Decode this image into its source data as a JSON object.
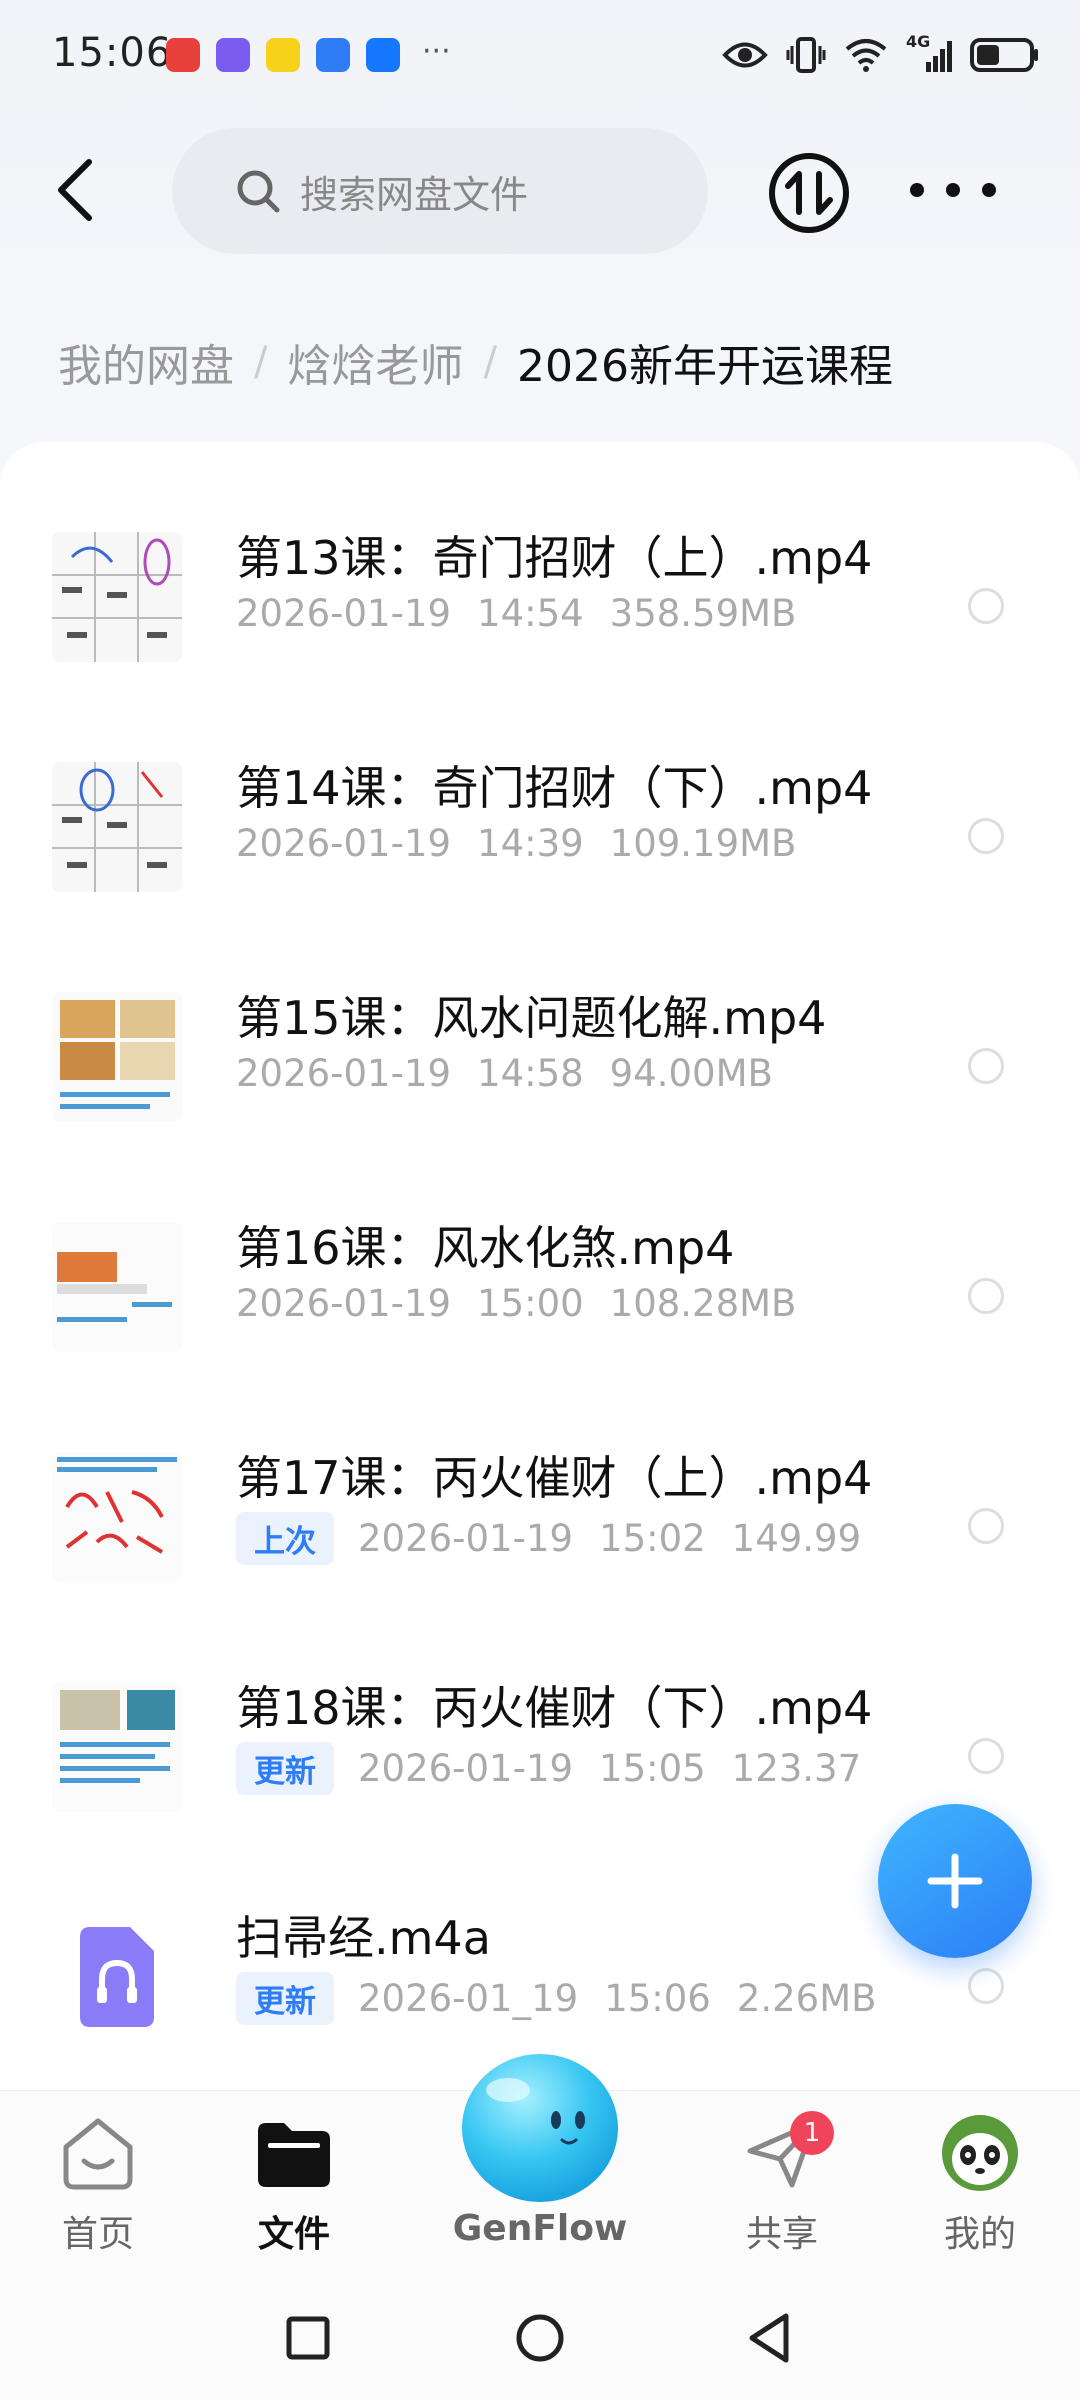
{
  "status_bar": {
    "time": "15:06",
    "app_icons": [
      {
        "name": "huawei-app-icon",
        "color": "#e8413c"
      },
      {
        "name": "robot-app-icon",
        "color": "#7a5cf0"
      },
      {
        "name": "meituan-app-icon",
        "color": "#f7d21b"
      },
      {
        "name": "blue-app-icon",
        "color": "#2e7cf6"
      },
      {
        "name": "alipay-app-icon",
        "color": "#1677ff"
      }
    ],
    "more": "···",
    "network": "4G"
  },
  "header": {
    "search_placeholder": "搜索网盘文件"
  },
  "breadcrumb": {
    "items": [
      "我的网盘",
      "焓焓老师"
    ],
    "current": "2026新年开运课程"
  },
  "files": [
    {
      "name": "第13课：奇门招财（上）.mp4",
      "date": "2026-01-19",
      "time": "14:54",
      "size": "358.59MB",
      "tag": ""
    },
    {
      "name": "第14课：奇门招财（下）.mp4",
      "date": "2026-01-19",
      "time": "14:39",
      "size": "109.19MB",
      "tag": ""
    },
    {
      "name": "第15课：风水问题化解.mp4",
      "date": "2026-01-19",
      "time": "14:58",
      "size": "94.00MB",
      "tag": ""
    },
    {
      "name": "第16课：风水化煞.mp4",
      "date": "2026-01-19",
      "time": "15:00",
      "size": "108.28MB",
      "tag": ""
    },
    {
      "name": "第17课：丙火催财（上）.mp4",
      "date": "2026-01-19",
      "time": "15:02",
      "size": "149.99",
      "tag": "上次"
    },
    {
      "name": "第18课：丙火催财（下）.mp4",
      "date": "2026-01-19",
      "time": "15:05",
      "size": "123.37",
      "tag": "更新"
    },
    {
      "name": "扫帚经.m4a",
      "date": "2026-01_19",
      "time": "15:06",
      "size": "2.26MB",
      "tag": "更新"
    }
  ],
  "bottom_nav": {
    "home": "首页",
    "files": "文件",
    "genflow": "GenFlow",
    "share": "共享",
    "share_badge": "1",
    "mine": "我的"
  },
  "colors": {
    "accent": "#2e7cf6",
    "badge": "#f0445a"
  }
}
